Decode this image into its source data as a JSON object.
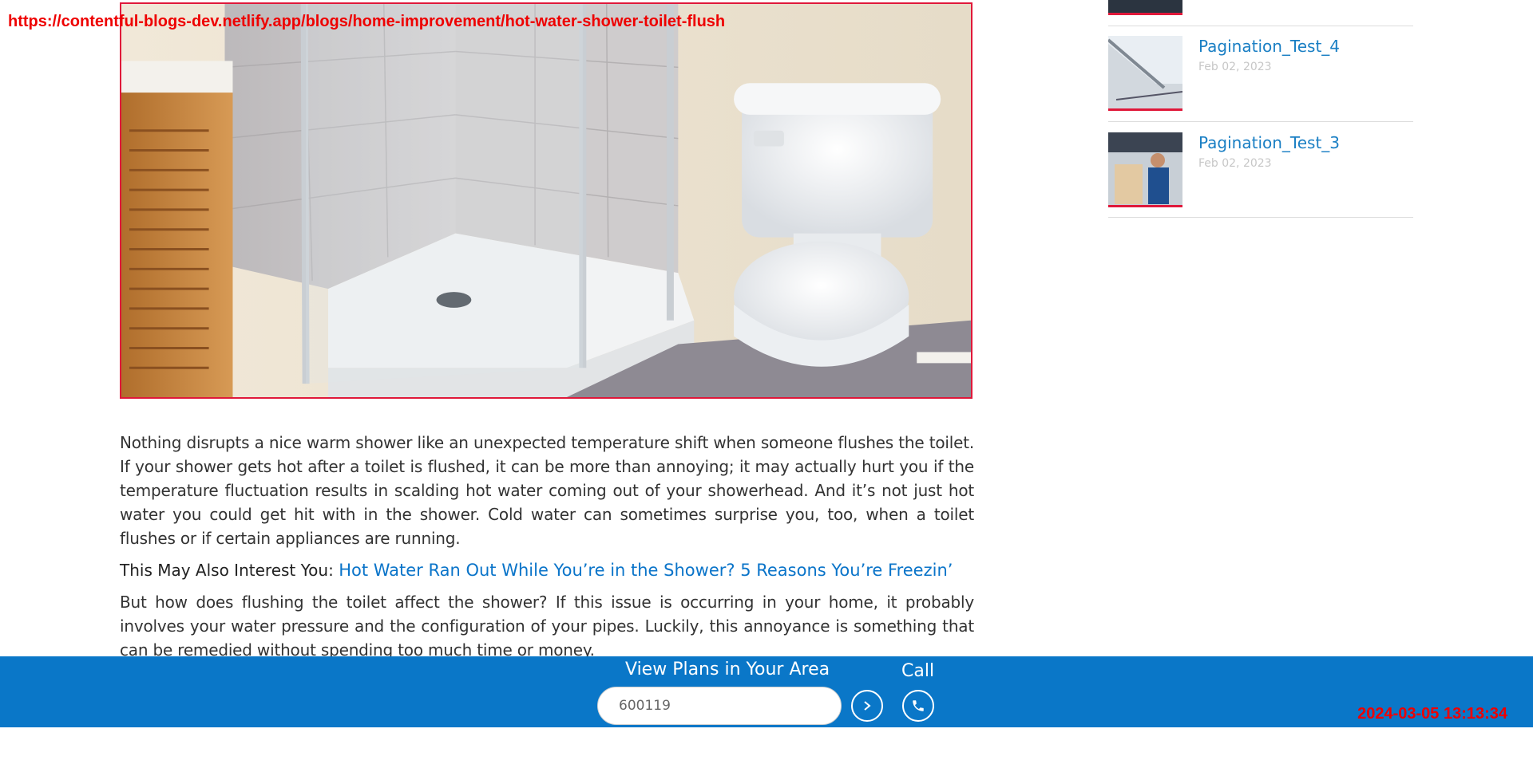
{
  "overlay": {
    "url": "https://contentful-blogs-dev.netlify.app/blogs/home-improvement/hot-water-shower-toilet-flush",
    "timestamp": "2024-03-05 13:13:34"
  },
  "hero": {
    "alt": "Corner glass shower stall next to a white toilet"
  },
  "article": {
    "p1": "Nothing disrupts a nice warm shower like an unexpected temperature shift when someone flushes the toilet. If your shower gets hot after a toilet is flushed, it can be more than annoying; it may actually hurt you if the temperature fluctuation results in scalding hot water coming out of your showerhead. And it’s not just hot water you could get hit with in the shower. Cold water can sometimes surprise you, too, when a toilet flushes or if certain appliances are running.",
    "also_lead": "This May Also Interest You:",
    "also_link": "Hot Water Ran Out While You’re in the Shower? 5 Reasons You’re Freezin’",
    "p2": "But how does flushing the toilet affect the shower? If this issue is occurring in your home, it probably involves your water pressure and the configuration of your pipes. Luckily, this annoyance is something that can be remedied without spending too much time or money."
  },
  "sidebar": {
    "items": [
      {
        "title": "Pagination_Test_4",
        "date": "Feb 02, 2023"
      },
      {
        "title": "Pagination_Test_3",
        "date": "Feb 02, 2023"
      }
    ]
  },
  "bottom_bar": {
    "plans_label": "View Plans in Your Area",
    "zip_value": "600119",
    "call_label": "Call",
    "go_icon": "chevron-right-icon",
    "phone_icon": "phone-icon"
  },
  "colors": {
    "brand_blue": "#0a77c8",
    "accent_red": "#e0183a",
    "link_blue": "#1a7fc4"
  }
}
